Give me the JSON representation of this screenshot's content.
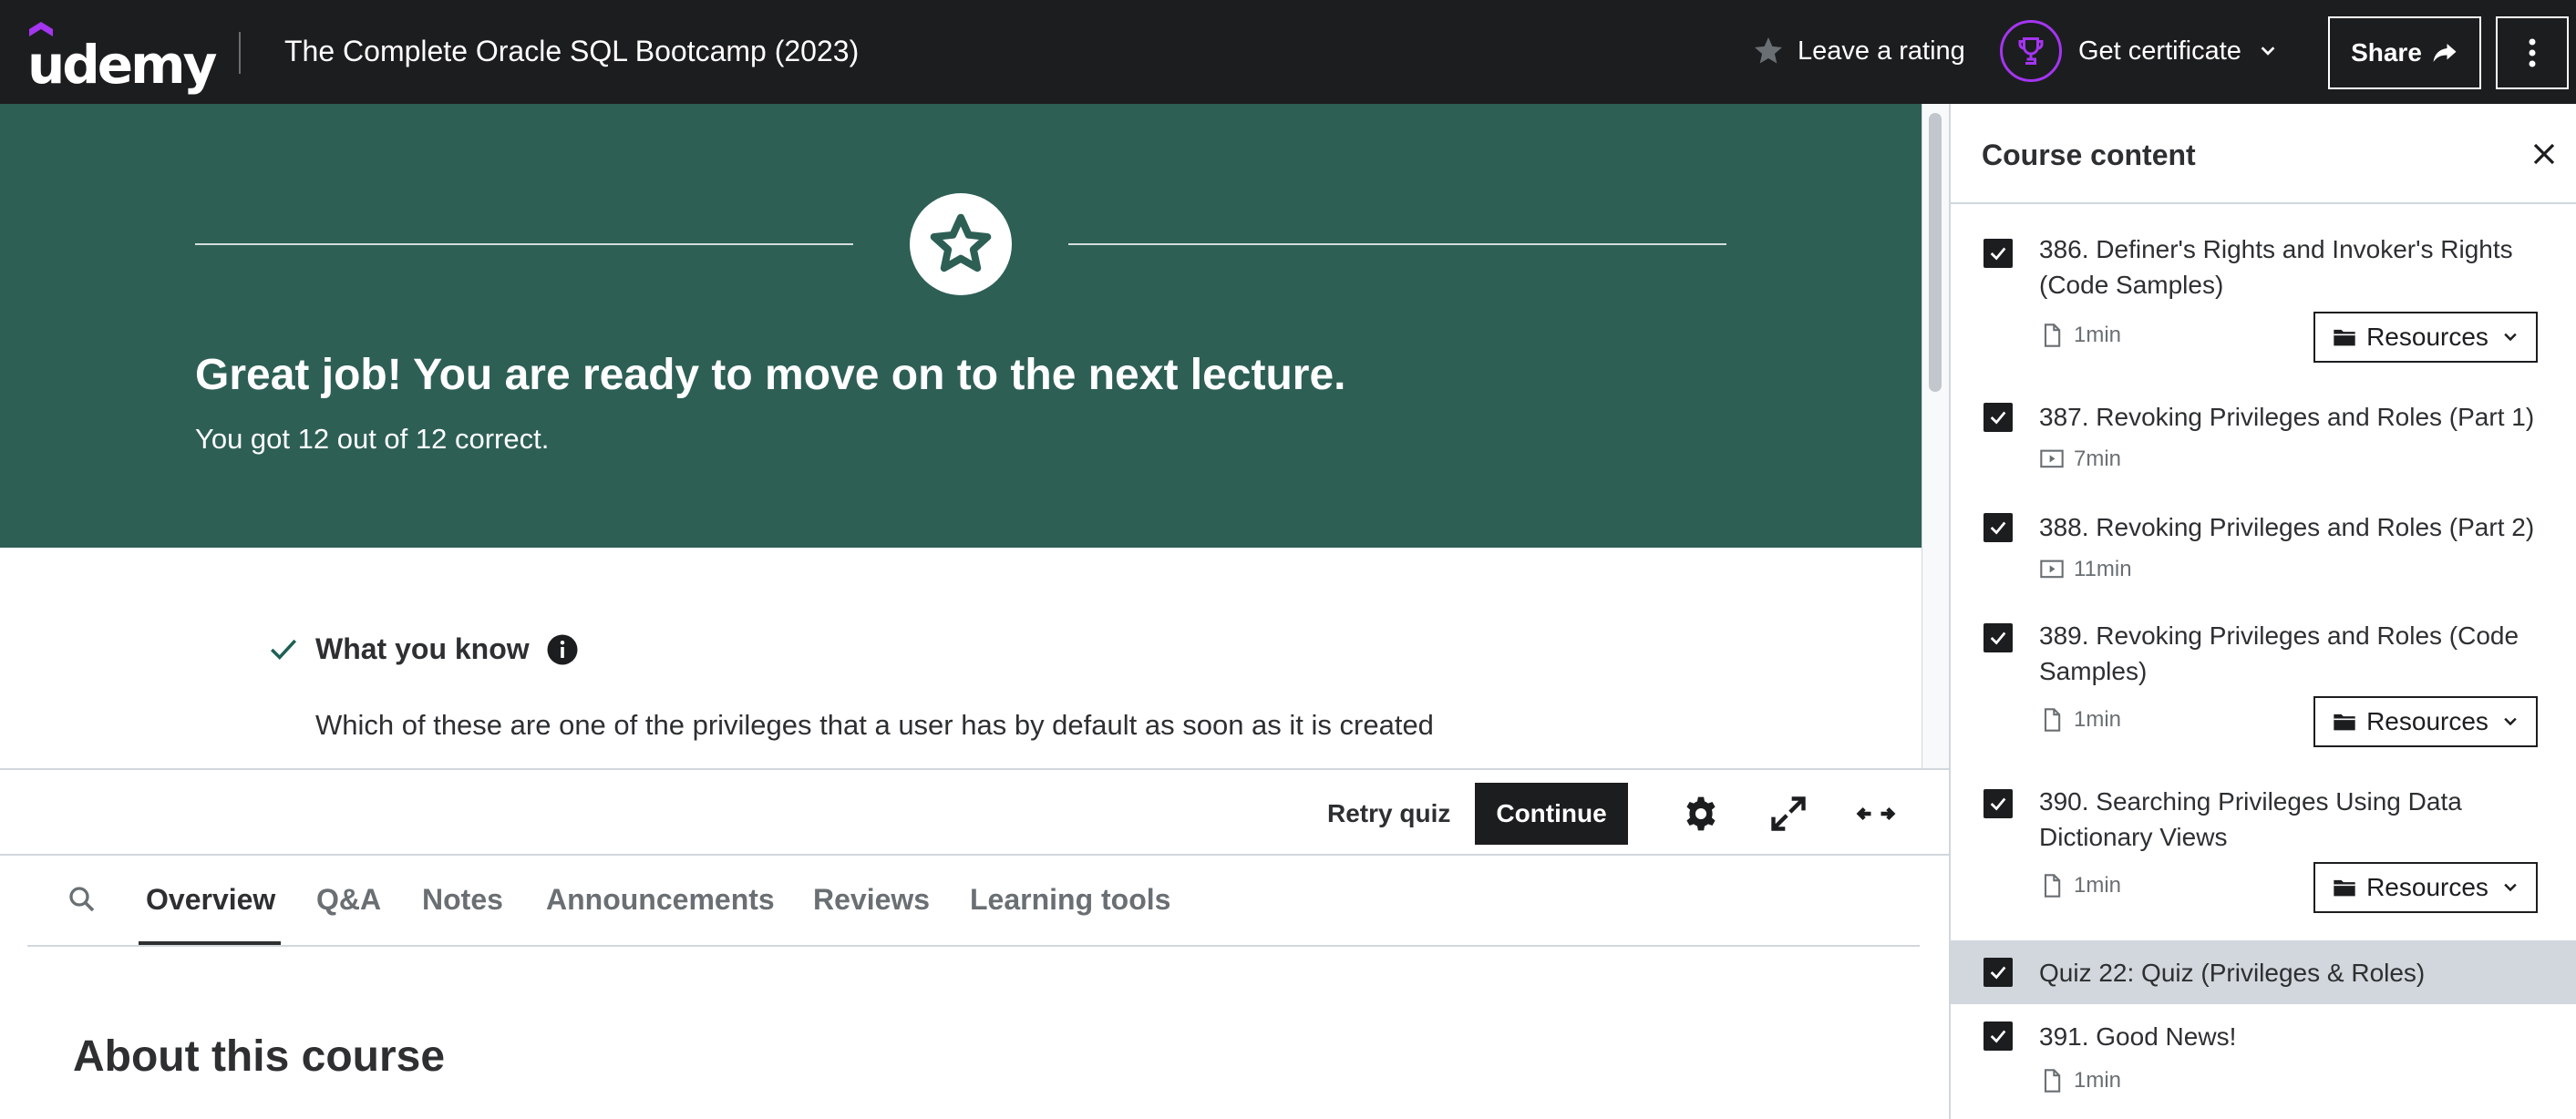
{
  "header": {
    "logo": "udemy",
    "course_title": "The Complete Oracle SQL Bootcamp (2023)",
    "rating_label": "Leave a rating",
    "certificate_label": "Get certificate",
    "share_label": "Share",
    "icons": [
      "star-icon",
      "trophy-icon",
      "chevron-down-icon",
      "share-arrow-icon",
      "more-vertical-icon"
    ]
  },
  "banner": {
    "title": "Great job! You are ready to move on to the next lecture.",
    "subtitle": "You got 12 out of 12 correct.",
    "icon": "star-icon",
    "color": "#2d5f55"
  },
  "quiz": {
    "section_label": "What you know",
    "question": "Which of these are one of the privileges that a user has by default as soon as it is created"
  },
  "controls": {
    "retry_label": "Retry quiz",
    "continue_label": "Continue",
    "icons": [
      "settings-icon",
      "fullscreen-icon",
      "expand-icon"
    ]
  },
  "tabs": {
    "items": [
      "Overview",
      "Q&A",
      "Notes",
      "Announcements",
      "Reviews",
      "Learning tools"
    ],
    "active": "Overview"
  },
  "about": {
    "heading": "About this course"
  },
  "sidebar": {
    "title": "Course content",
    "resources_label": "Resources",
    "items": [
      {
        "label": "386. Definer's Rights and Invoker's Rights (Code Samples)",
        "duration": "1min",
        "type": "file",
        "completed": true,
        "resources": true
      },
      {
        "label": "387. Revoking Privileges and Roles (Part 1)",
        "duration": "7min",
        "type": "video",
        "completed": true,
        "resources": false
      },
      {
        "label": "388. Revoking Privileges and Roles (Part 2)",
        "duration": "11min",
        "type": "video",
        "completed": true,
        "resources": false
      },
      {
        "label": "389. Revoking Privileges and Roles (Code Samples)",
        "duration": "1min",
        "type": "file",
        "completed": true,
        "resources": true
      },
      {
        "label": "390. Searching Privileges Using Data Dictionary Views",
        "duration": "1min",
        "type": "file",
        "completed": true,
        "resources": true
      },
      {
        "label": "Quiz 22: Quiz (Privileges & Roles)",
        "duration": "",
        "type": "quiz",
        "completed": true,
        "resources": false,
        "active": true
      },
      {
        "label": "391. Good News!",
        "duration": "1min",
        "type": "file",
        "completed": true,
        "resources": false
      }
    ]
  },
  "colors": {
    "header_bg": "#1c1d1f",
    "banner_bg": "#2d5f55",
    "accent_purple": "#a435f0",
    "active_item_bg": "#d1d7dc"
  }
}
